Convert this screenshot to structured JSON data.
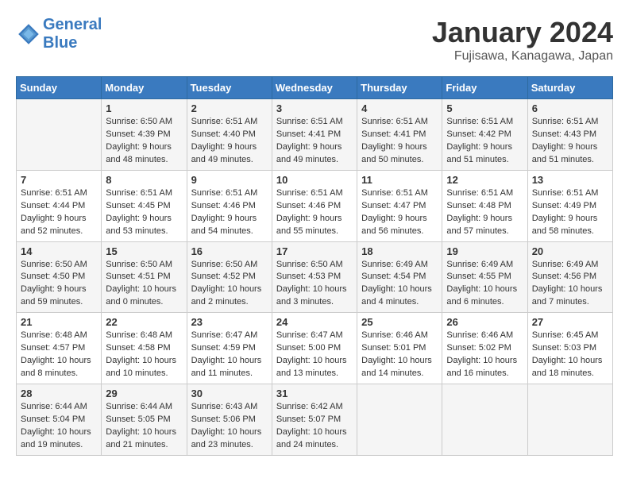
{
  "header": {
    "logo_line1": "General",
    "logo_line2": "Blue",
    "month": "January 2024",
    "location": "Fujisawa, Kanagawa, Japan"
  },
  "days_of_week": [
    "Sunday",
    "Monday",
    "Tuesday",
    "Wednesday",
    "Thursday",
    "Friday",
    "Saturday"
  ],
  "weeks": [
    [
      {
        "day": "",
        "sunrise": "",
        "sunset": "",
        "daylight": ""
      },
      {
        "day": "1",
        "sunrise": "6:50 AM",
        "sunset": "4:39 PM",
        "daylight": "9 hours and 48 minutes."
      },
      {
        "day": "2",
        "sunrise": "6:51 AM",
        "sunset": "4:40 PM",
        "daylight": "9 hours and 49 minutes."
      },
      {
        "day": "3",
        "sunrise": "6:51 AM",
        "sunset": "4:41 PM",
        "daylight": "9 hours and 49 minutes."
      },
      {
        "day": "4",
        "sunrise": "6:51 AM",
        "sunset": "4:41 PM",
        "daylight": "9 hours and 50 minutes."
      },
      {
        "day": "5",
        "sunrise": "6:51 AM",
        "sunset": "4:42 PM",
        "daylight": "9 hours and 51 minutes."
      },
      {
        "day": "6",
        "sunrise": "6:51 AM",
        "sunset": "4:43 PM",
        "daylight": "9 hours and 51 minutes."
      }
    ],
    [
      {
        "day": "7",
        "sunrise": "6:51 AM",
        "sunset": "4:44 PM",
        "daylight": "9 hours and 52 minutes."
      },
      {
        "day": "8",
        "sunrise": "6:51 AM",
        "sunset": "4:45 PM",
        "daylight": "9 hours and 53 minutes."
      },
      {
        "day": "9",
        "sunrise": "6:51 AM",
        "sunset": "4:46 PM",
        "daylight": "9 hours and 54 minutes."
      },
      {
        "day": "10",
        "sunrise": "6:51 AM",
        "sunset": "4:46 PM",
        "daylight": "9 hours and 55 minutes."
      },
      {
        "day": "11",
        "sunrise": "6:51 AM",
        "sunset": "4:47 PM",
        "daylight": "9 hours and 56 minutes."
      },
      {
        "day": "12",
        "sunrise": "6:51 AM",
        "sunset": "4:48 PM",
        "daylight": "9 hours and 57 minutes."
      },
      {
        "day": "13",
        "sunrise": "6:51 AM",
        "sunset": "4:49 PM",
        "daylight": "9 hours and 58 minutes."
      }
    ],
    [
      {
        "day": "14",
        "sunrise": "6:50 AM",
        "sunset": "4:50 PM",
        "daylight": "9 hours and 59 minutes."
      },
      {
        "day": "15",
        "sunrise": "6:50 AM",
        "sunset": "4:51 PM",
        "daylight": "10 hours and 0 minutes."
      },
      {
        "day": "16",
        "sunrise": "6:50 AM",
        "sunset": "4:52 PM",
        "daylight": "10 hours and 2 minutes."
      },
      {
        "day": "17",
        "sunrise": "6:50 AM",
        "sunset": "4:53 PM",
        "daylight": "10 hours and 3 minutes."
      },
      {
        "day": "18",
        "sunrise": "6:49 AM",
        "sunset": "4:54 PM",
        "daylight": "10 hours and 4 minutes."
      },
      {
        "day": "19",
        "sunrise": "6:49 AM",
        "sunset": "4:55 PM",
        "daylight": "10 hours and 6 minutes."
      },
      {
        "day": "20",
        "sunrise": "6:49 AM",
        "sunset": "4:56 PM",
        "daylight": "10 hours and 7 minutes."
      }
    ],
    [
      {
        "day": "21",
        "sunrise": "6:48 AM",
        "sunset": "4:57 PM",
        "daylight": "10 hours and 8 minutes."
      },
      {
        "day": "22",
        "sunrise": "6:48 AM",
        "sunset": "4:58 PM",
        "daylight": "10 hours and 10 minutes."
      },
      {
        "day": "23",
        "sunrise": "6:47 AM",
        "sunset": "4:59 PM",
        "daylight": "10 hours and 11 minutes."
      },
      {
        "day": "24",
        "sunrise": "6:47 AM",
        "sunset": "5:00 PM",
        "daylight": "10 hours and 13 minutes."
      },
      {
        "day": "25",
        "sunrise": "6:46 AM",
        "sunset": "5:01 PM",
        "daylight": "10 hours and 14 minutes."
      },
      {
        "day": "26",
        "sunrise": "6:46 AM",
        "sunset": "5:02 PM",
        "daylight": "10 hours and 16 minutes."
      },
      {
        "day": "27",
        "sunrise": "6:45 AM",
        "sunset": "5:03 PM",
        "daylight": "10 hours and 18 minutes."
      }
    ],
    [
      {
        "day": "28",
        "sunrise": "6:44 AM",
        "sunset": "5:04 PM",
        "daylight": "10 hours and 19 minutes."
      },
      {
        "day": "29",
        "sunrise": "6:44 AM",
        "sunset": "5:05 PM",
        "daylight": "10 hours and 21 minutes."
      },
      {
        "day": "30",
        "sunrise": "6:43 AM",
        "sunset": "5:06 PM",
        "daylight": "10 hours and 23 minutes."
      },
      {
        "day": "31",
        "sunrise": "6:42 AM",
        "sunset": "5:07 PM",
        "daylight": "10 hours and 24 minutes."
      },
      {
        "day": "",
        "sunrise": "",
        "sunset": "",
        "daylight": ""
      },
      {
        "day": "",
        "sunrise": "",
        "sunset": "",
        "daylight": ""
      },
      {
        "day": "",
        "sunrise": "",
        "sunset": "",
        "daylight": ""
      }
    ]
  ]
}
